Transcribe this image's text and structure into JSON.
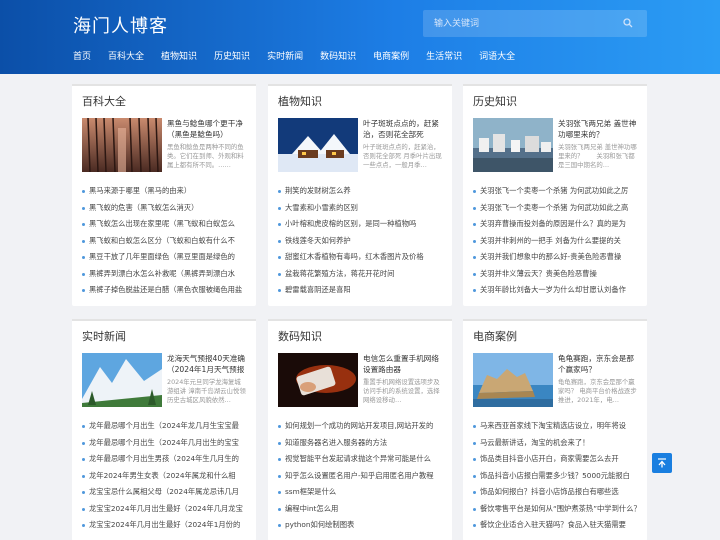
{
  "site": {
    "title": "海门人博客"
  },
  "search": {
    "placeholder": "输入关键词"
  },
  "nav": [
    "首页",
    "百科大全",
    "植物知识",
    "历史知识",
    "实时新闻",
    "数码知识",
    "电商案例",
    "生活常识",
    "词语大全"
  ],
  "cards": [
    {
      "title": "百科大全",
      "feature_title": "黑鱼与鲶鱼哪个更干净（黑鱼是鲶鱼吗）",
      "feature_desc": "黑鱼和鲶鱼是两种不同的鱼类。它们在到师、外观和料属上都有所不同。……",
      "thumb": "forest",
      "items": [
        "黑马来源于哪里（黑马的由来）",
        "黑飞蚁的危害（黑飞蚁怎么消灭）",
        "黑飞蚁怎么出现在家里呢（黑飞蚁和白蚁怎么",
        "黑飞蚁和白蚁怎么区分（飞蚁和白蚁有什么不",
        "黑豆干放了几年里面绿色（黑豆里面是绿色的",
        "黑裤弄到漂白水怎么补救呢（黑裤弄到漂白水",
        "黑裤子掉色脱盐还是白醋（黑色衣服被绳色用盐"
      ]
    },
    {
      "title": "植物知识",
      "feature_title": "叶子斑斑点点的，赶紧治，否则花全部死",
      "feature_desc": "叶子斑斑点点的，赶紧治，否则花全部死 月季叶片出现一些点点，一般月季…",
      "thumb": "snow",
      "items": [
        "荆笑的发财树怎么养",
        "大雪素和小雪素的区别",
        "小叶榕和虎皮榕的区别，是同一种植物吗",
        "铁线莲冬天如何养护",
        "甜蜜红木香植物有毒吗，红木香图片及价格",
        "盆栽蒋花繁殖方法，蒋花开花时间",
        "碧雷载喜阴还是喜阳"
      ]
    },
    {
      "title": "历史知识",
      "feature_title": "关羽张飞两兄弟 盖世神功哪里来的？",
      "feature_desc": "关羽张飞两兄弟 盖世神功哪里来的？　　关羽和张飞都是三国中期名的…",
      "thumb": "city",
      "items": [
        "关羽张飞一个卖枣一个杀猪 为何武功如此之厉",
        "关羽张飞一个卖枣一个杀猪 为何武功如此之高",
        "关羽弃曹操而投刘备的原因是什么？真的是为",
        "关羽并非刺州的一把手 刘备为什么要提的关",
        "关羽并我们想象中的那么好-贵美色险恶曹操",
        "关羽并非义薄云天？贵美色险恶曹操",
        "关羽年龄比刘备大一岁为什么却甘愿认刘备作"
      ]
    },
    {
      "title": "实时新闻",
      "feature_title": "龙海天气预报40天准确（2024年1月天气预报",
      "feature_desc": "2024年元旦同学龙海复城游组讲 漳南千岛湖云山悦领 历史古城区风貌依然…",
      "thumb": "mountain",
      "items": [
        "龙年最忌哪个月出生（2024年龙几月生宝宝最",
        "龙年最忌哪个月出生（2024年几月出生的宝宝",
        "龙年最忌哪个月出生男孩（2024年生几月生的",
        "龙年2024年男生女表（2024年属龙和什么相",
        "龙宝宝忌什么属相父母（2024年属龙忌讳几月",
        "龙宝宝2024年几月出生最好（2024年几月龙宝",
        "龙宝宝2024年几月出生最好（2024年1月份的"
      ]
    },
    {
      "title": "数码知识",
      "feature_title": "电信怎么重置手机网络设置路由器",
      "feature_desc": "重置手机网络设置选项步及访问手机的系统设置，选择网络设移动…",
      "thumb": "phone",
      "items": [
        "如何规划一个成功的网站开发项目,网站开发的",
        "知道服务器名进入服务器的方法",
        "视觉智能平台发起请求抛这个异常可能是什么",
        "知乎怎么设置匿名用户-知乎启用匿名用户教程",
        "ssm框架是什么",
        "编程中int怎么用",
        "python如何绘制图表"
      ]
    },
    {
      "title": "电商案例",
      "feature_title": "龟龟赛跑，京东会是那个赢家吗？",
      "feature_desc": "龟龟赛跑，京东会是那个赢家吗？ 电商平台价格战逐步推进，2021年，电…",
      "thumb": "coast",
      "items": [
        "马来西亚首家线下淘宝精选店设立，明年将设",
        "马云最新讲话，淘宝的机会来了！",
        "饰品类目抖音小店开白，商家需要怎么去开",
        "饰品抖音小店报白需要多少钱？5000元能报白",
        "饰品如何报白？抖音小店饰品报白有哪些选",
        "餐饮零售平台是如何从“围炉煮茶热”中学到什么？",
        "餐饮企业适合入驻天猫吗？食品入驻天猫需要"
      ]
    }
  ]
}
